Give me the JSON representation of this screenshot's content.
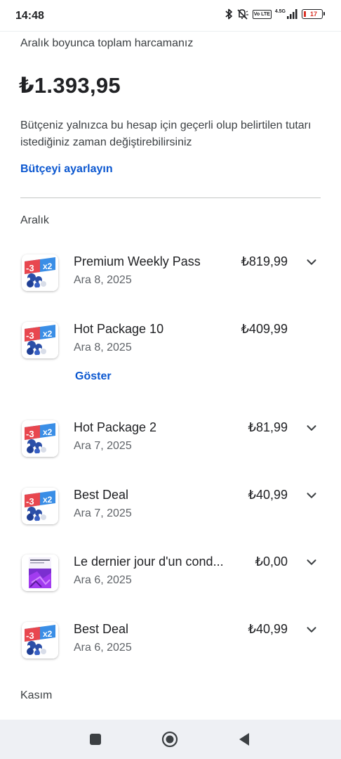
{
  "status_bar": {
    "time": "14:48",
    "icons": [
      "bluetooth-icon",
      "mute-vibrate-icon",
      "volte-icon",
      "signal-icon",
      "battery-icon"
    ],
    "volte_text": "Vo LTE",
    "network_text": "4.5G",
    "battery_level": "17"
  },
  "summary": {
    "header_label": "Aralık boyunca toplam harcamanız",
    "total": "₺1.393,95",
    "budget_description": "Bütçeniz yalnızca bu hesap için geçerli olup belirtilen tutarı istediğiniz zaman değiştirebilirsiniz",
    "budget_link": "Bütçeyi ayarlayın"
  },
  "months": [
    {
      "label": "Aralık",
      "items": [
        {
          "title": "Premium Weekly Pass",
          "date": "Ara 8, 2025",
          "price": "₺819,99",
          "icon": "game-app-icon",
          "expand": "chevron-down-icon"
        },
        {
          "title": "Hot Package 10",
          "date": "Ara 8, 2025",
          "price": "₺409,99",
          "icon": "game-app-icon",
          "action": "Göster"
        },
        {
          "title": "Hot Package 2",
          "date": "Ara 7, 2025",
          "price": "₺81,99",
          "icon": "game-app-icon",
          "expand": "chevron-down-icon"
        },
        {
          "title": "Best Deal",
          "date": "Ara 7, 2025",
          "price": "₺40,99",
          "icon": "game-app-icon",
          "expand": "chevron-down-icon"
        },
        {
          "title": "Le dernier jour d'un cond...",
          "date": "Ara 6, 2025",
          "price": "₺0,00",
          "icon": "book-cover-icon",
          "expand": "chevron-down-icon"
        },
        {
          "title": "Best Deal",
          "date": "Ara 6, 2025",
          "price": "₺40,99",
          "icon": "game-app-icon",
          "expand": "chevron-down-icon"
        }
      ]
    },
    {
      "label": "Kasım",
      "items": []
    }
  ],
  "nav_bar": {
    "buttons": [
      "recents-icon",
      "home-icon",
      "back-icon"
    ]
  },
  "colors": {
    "accent": "#0b57d0",
    "text_primary": "#202124",
    "text_secondary": "#5f6368",
    "battery_low": "#d93025"
  }
}
